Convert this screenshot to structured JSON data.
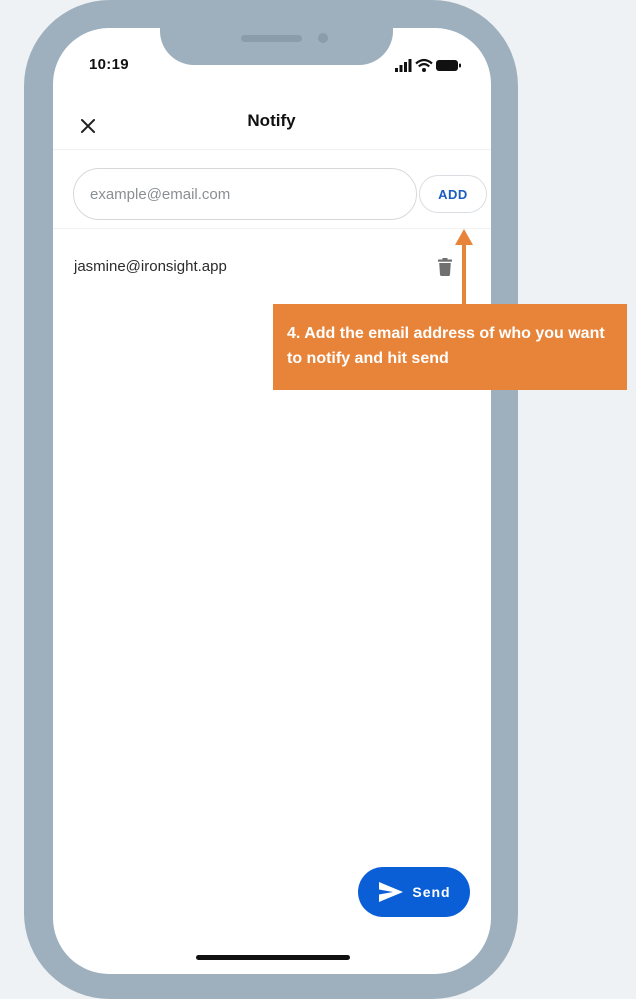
{
  "status_bar": {
    "time": "10:19"
  },
  "header": {
    "title": "Notify"
  },
  "email_input": {
    "placeholder": "example@email.com",
    "value": ""
  },
  "add_button": {
    "label": "ADD"
  },
  "recipients": [
    "jasmine@ironsight.app"
  ],
  "callout": {
    "text": "4. Add the email address of who you want to notify and hit send"
  },
  "send_button": {
    "label": "Send"
  },
  "icons": {
    "close": "close-icon",
    "delete": "trash-icon",
    "send": "send-icon",
    "signal": "signal-icon",
    "wifi": "wifi-icon",
    "battery": "battery-icon"
  },
  "colors": {
    "frame": "#9eafbd",
    "accent": "#0a5fd6",
    "add_text": "#1a5fbf",
    "callout": "#e8843a",
    "background": "#eef2f5"
  }
}
